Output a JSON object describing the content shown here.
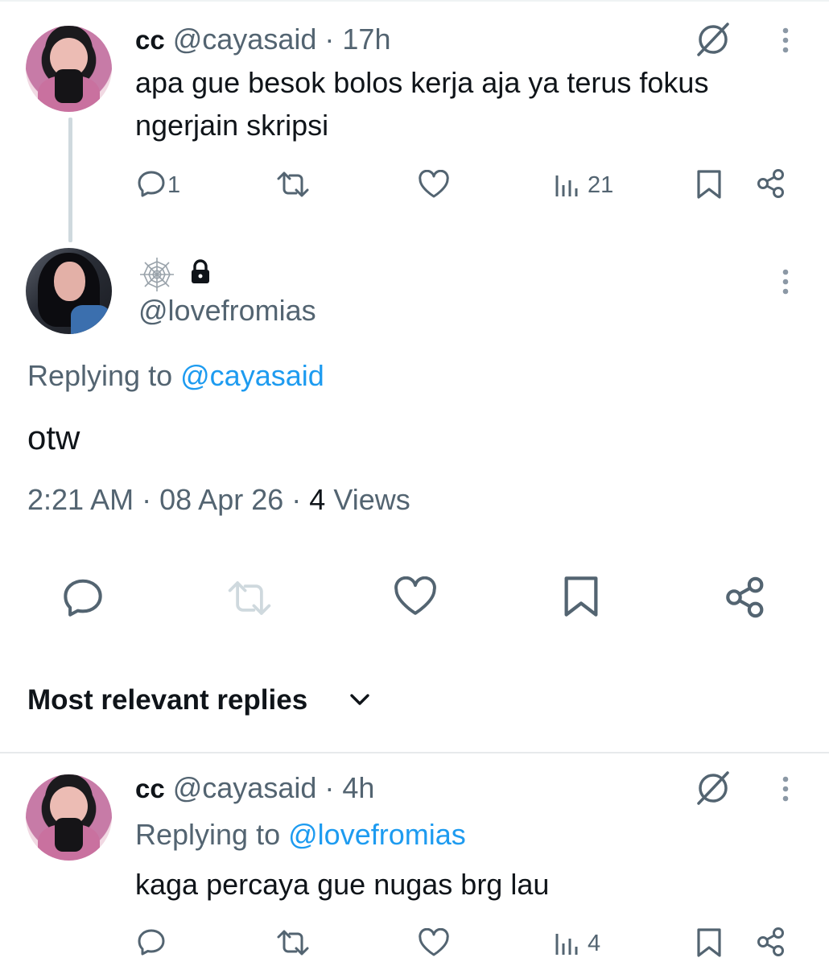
{
  "tweet1": {
    "name": "cc",
    "handle": "@cayasaid",
    "dot": "·",
    "time": "17h",
    "text": "apa gue besok bolos kerja aja ya terus fokus ngerjain skripsi",
    "reply_count": "1",
    "view_count": "21"
  },
  "focus": {
    "handle": "@lovefromias",
    "replying_prefix": "Replying to",
    "replying_handle": "@cayasaid",
    "text": "otw",
    "time": "2:21 AM",
    "sep1": "·",
    "date": "08 Apr 26",
    "sep2": "·",
    "views_count": "4",
    "views_label": "Views"
  },
  "replies_header": {
    "label": "Most relevant replies"
  },
  "tweet2": {
    "name": "cc",
    "handle": "@cayasaid",
    "dot": "·",
    "time": "4h",
    "replying_prefix": "Replying to",
    "replying_handle": "@lovefromias",
    "text": "kaga percaya gue nugas brg lau",
    "view_count": "4"
  },
  "colors": {
    "text": "#0f1419",
    "muted": "#536471",
    "link": "#1d9bf0",
    "thread_line": "#cfd9de"
  },
  "icons": [
    "grok-icon",
    "more-icon",
    "reply-icon",
    "retweet-icon",
    "like-icon",
    "views-icon",
    "bookmark-icon",
    "share-icon",
    "spiderweb-icon",
    "lock-icon",
    "chevron-down-icon"
  ]
}
